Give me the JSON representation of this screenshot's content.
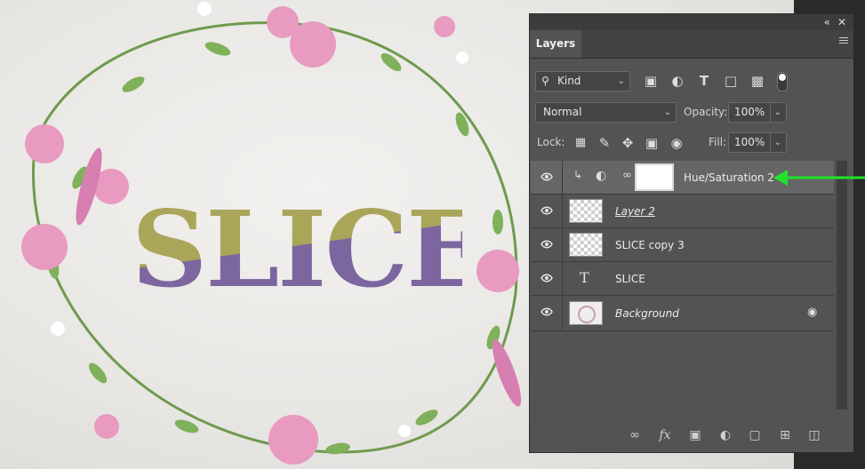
{
  "canvas": {
    "text": "SLICE"
  },
  "panel": {
    "tab": "Layers",
    "filter": {
      "label": "Kind"
    },
    "blend_mode": {
      "value": "Normal"
    },
    "opacity": {
      "label": "Opacity:",
      "value": "100%"
    },
    "lock": {
      "label": "Lock:"
    },
    "fill": {
      "label": "Fill:",
      "value": "100%"
    },
    "layers": [
      {
        "name": "Hue/Saturation 2",
        "selected": true,
        "type": "adjustment"
      },
      {
        "name": "Layer 2",
        "selected": false,
        "type": "pixel"
      },
      {
        "name": "SLICE copy 3",
        "selected": false,
        "type": "pixel"
      },
      {
        "name": "SLICE",
        "selected": false,
        "type": "text"
      },
      {
        "name": "Background",
        "selected": false,
        "type": "background",
        "locked": true
      }
    ]
  },
  "annotation": {
    "arrow_color": "#22e12a"
  }
}
